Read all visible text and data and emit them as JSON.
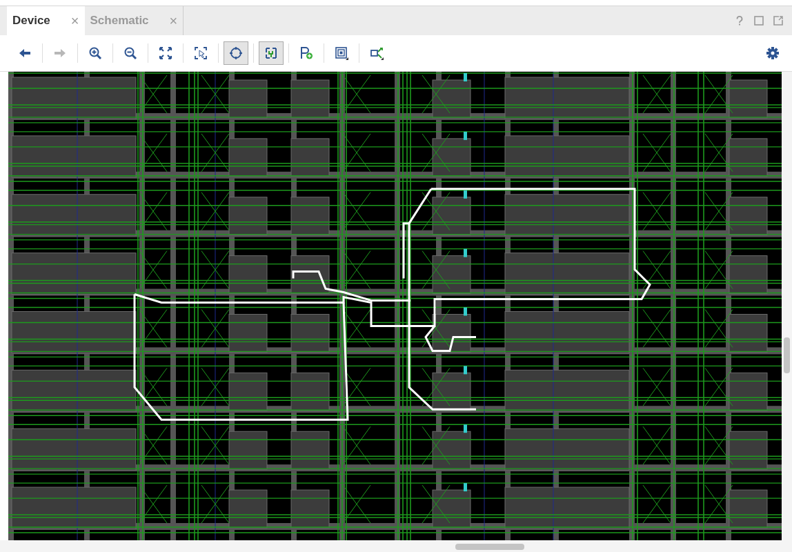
{
  "tabs": [
    {
      "label": "Device",
      "selected": true,
      "close": "×"
    },
    {
      "label": "Schematic",
      "selected": false,
      "close": "×"
    }
  ],
  "window_buttons": [
    {
      "kind": "help"
    },
    {
      "kind": "maximize"
    },
    {
      "kind": "float"
    }
  ],
  "toolbar": [
    {
      "kind": "back",
      "disabled": false,
      "on": false
    },
    {
      "kind": "forward",
      "disabled": true,
      "on": false
    },
    {
      "kind": "zoom-in",
      "disabled": false,
      "on": false
    },
    {
      "kind": "zoom-out",
      "disabled": false,
      "on": false
    },
    {
      "kind": "fit",
      "disabled": false,
      "on": false
    },
    {
      "kind": "zoom-selection",
      "disabled": false,
      "on": false
    },
    {
      "kind": "autofit",
      "disabled": false,
      "on": true
    },
    {
      "kind": "routing",
      "disabled": false,
      "on": true
    },
    {
      "kind": "pblock",
      "disabled": false,
      "on": false
    },
    {
      "kind": "cell-view",
      "disabled": false,
      "on": false
    },
    {
      "kind": "net-view",
      "disabled": false,
      "on": false
    }
  ],
  "settings": {
    "kind": "gear"
  }
}
